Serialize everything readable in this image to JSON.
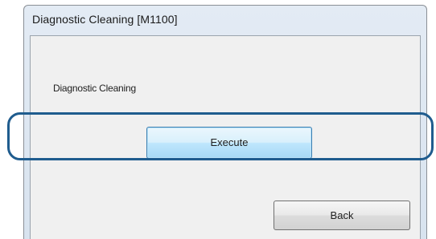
{
  "window": {
    "title": "Diagnostic Cleaning [M1100]"
  },
  "content": {
    "section_label": "Diagnostic Cleaning",
    "execute_label": "Execute",
    "back_label": "Back"
  },
  "colors": {
    "highlight_ring": "#1f5c8e",
    "execute_border": "#3c7fb1",
    "client_background": "#f0f0f0"
  }
}
